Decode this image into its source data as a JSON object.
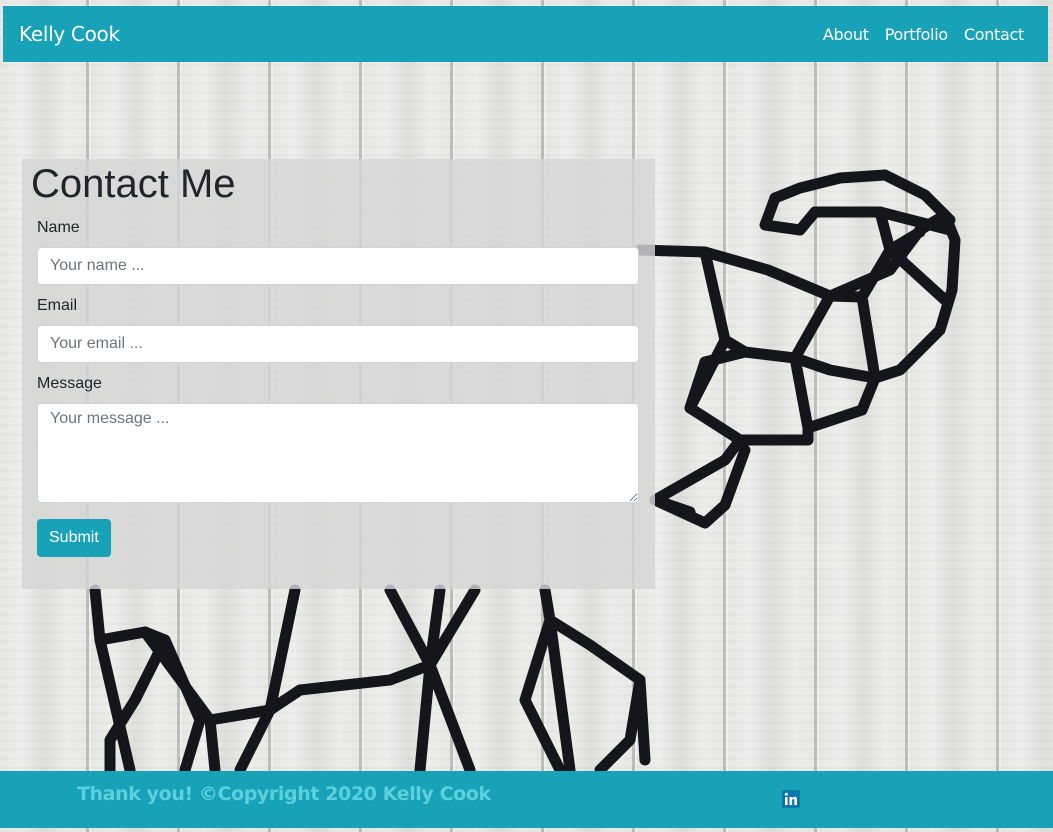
{
  "navbar": {
    "brand": "Kelly Cook",
    "links": [
      "About",
      "Portfolio",
      "Contact"
    ]
  },
  "contact": {
    "title": "Contact Me",
    "name_label": "Name",
    "name_placeholder": "Your name ...",
    "email_label": "Email",
    "email_placeholder": "Your email ...",
    "message_label": "Message",
    "message_placeholder": "Your message ...",
    "submit_label": "Submit"
  },
  "footer": {
    "text": "Thank you! ©Copyright 2020 Kelly Cook",
    "social_icon": "linkedin-icon"
  },
  "colors": {
    "accent": "#17a2b8",
    "footer_text": "#5dd0df",
    "linkedin": "#0e76a8"
  }
}
